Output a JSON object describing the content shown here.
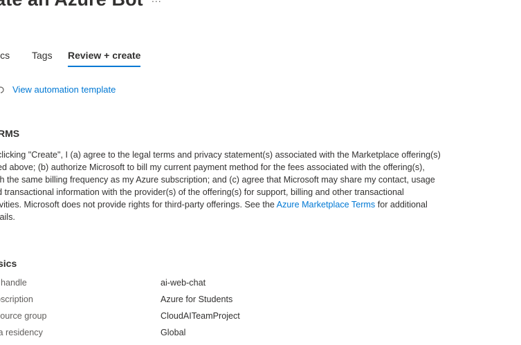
{
  "header": {
    "title": "eate an Azure Bot",
    "more": "..."
  },
  "tabs": [
    {
      "label": "sics",
      "active": false
    },
    {
      "label": "Tags",
      "active": false
    },
    {
      "label": "Review + create",
      "active": true
    }
  ],
  "automation": {
    "icon": "download-template-icon",
    "link_label": "View automation template"
  },
  "terms": {
    "heading": "RMS",
    "lines": [
      "clicking \"Create\", I (a) agree to the legal terms and privacy statement(s) associated with the Marketplace offering(s)",
      "ed above; (b) authorize Microsoft to bill my current payment method for the fees associated with the offering(s),",
      "th the same billing frequency as my Azure subscription; and (c) agree that Microsoft may share my contact, usage",
      "d transactional information with the provider(s) of the offering(s) for support, billing and other transactional",
      "ivities. Microsoft does not provide rights for third-party offerings. See the "
    ],
    "link_text": "Azure Marketplace Terms",
    "after_link": " for additional",
    "last_line": "tails."
  },
  "basics": {
    "heading": "sics",
    "rows": [
      {
        "label": "t handle",
        "value": "ai-web-chat"
      },
      {
        "label": "bscription",
        "value": "Azure for Students"
      },
      {
        "label": "source group",
        "value": "CloudAITeamProject"
      },
      {
        "label": "ta residency",
        "value": "Global"
      }
    ]
  },
  "colors": {
    "accent": "#0078d4",
    "text": "#323130",
    "label": "#605e5c"
  }
}
